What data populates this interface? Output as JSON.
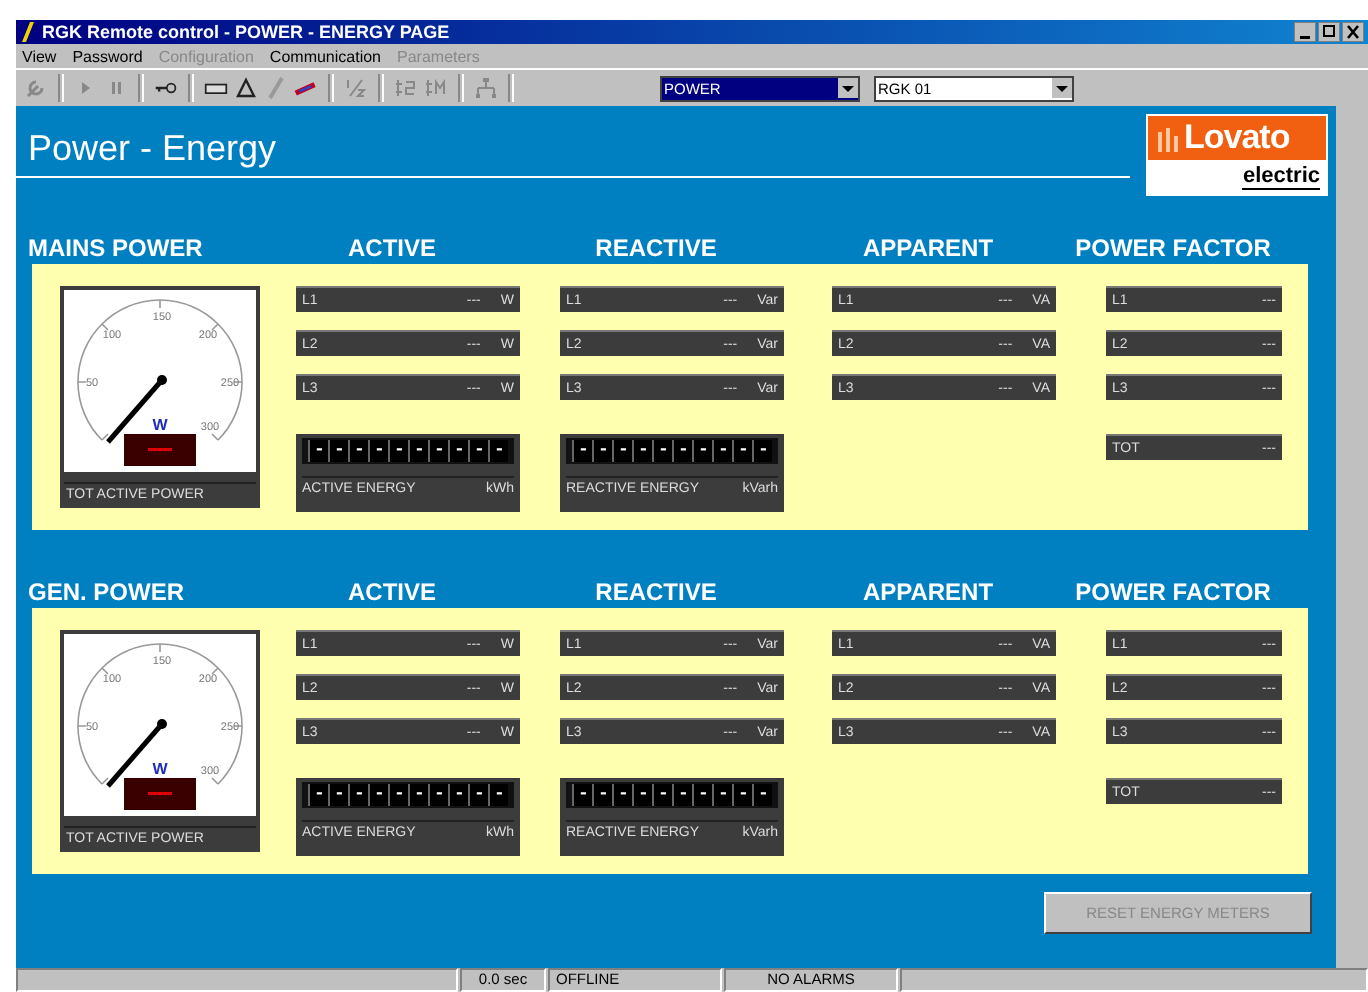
{
  "window": {
    "title": "RGK Remote control - POWER - ENERGY PAGE"
  },
  "menu": [
    {
      "label": "View",
      "disabled": false
    },
    {
      "label": "Password",
      "disabled": false
    },
    {
      "label": "Configuration",
      "disabled": true
    },
    {
      "label": "Communication",
      "disabled": false
    },
    {
      "label": "Parameters",
      "disabled": true
    }
  ],
  "toolbar": {
    "page_select": "POWER",
    "device_select": "RGK 01"
  },
  "page_title": "Power - Energy",
  "logo": {
    "brand": "Lovato",
    "sub": "electric"
  },
  "sections": [
    {
      "title": "MAINS POWER",
      "gauge": {
        "scale": [
          "50",
          "100",
          "150",
          "200",
          "250",
          "300"
        ],
        "unit": "W",
        "label": "TOT ACTIVE POWER"
      },
      "groups": [
        {
          "heading": "ACTIVE",
          "rows": [
            {
              "label": "L1",
              "value": "---",
              "unit": "W"
            },
            {
              "label": "L2",
              "value": "---",
              "unit": "W"
            },
            {
              "label": "L3",
              "value": "---",
              "unit": "W"
            }
          ],
          "energy": {
            "digits": "----------",
            "label": "ACTIVE ENERGY",
            "unit": "kWh"
          }
        },
        {
          "heading": "REACTIVE",
          "rows": [
            {
              "label": "L1",
              "value": "---",
              "unit": "Var"
            },
            {
              "label": "L2",
              "value": "---",
              "unit": "Var"
            },
            {
              "label": "L3",
              "value": "---",
              "unit": "Var"
            }
          ],
          "energy": {
            "digits": "----------",
            "label": "REACTIVE ENERGY",
            "unit": "kVarh"
          }
        },
        {
          "heading": "APPARENT",
          "rows": [
            {
              "label": "L1",
              "value": "---",
              "unit": "VA"
            },
            {
              "label": "L2",
              "value": "---",
              "unit": "VA"
            },
            {
              "label": "L3",
              "value": "---",
              "unit": "VA"
            }
          ]
        },
        {
          "heading": "POWER FACTOR",
          "rows": [
            {
              "label": "L1",
              "value": "---"
            },
            {
              "label": "L2",
              "value": "---"
            },
            {
              "label": "L3",
              "value": "---"
            }
          ],
          "total": {
            "label": "TOT",
            "value": "---"
          }
        }
      ]
    },
    {
      "title": "GEN. POWER",
      "gauge": {
        "scale": [
          "50",
          "100",
          "150",
          "200",
          "250",
          "300"
        ],
        "unit": "W",
        "label": "TOT ACTIVE POWER"
      },
      "groups": [
        {
          "heading": "ACTIVE",
          "rows": [
            {
              "label": "L1",
              "value": "---",
              "unit": "W"
            },
            {
              "label": "L2",
              "value": "---",
              "unit": "W"
            },
            {
              "label": "L3",
              "value": "---",
              "unit": "W"
            }
          ],
          "energy": {
            "digits": "----------",
            "label": "ACTIVE ENERGY",
            "unit": "kWh"
          }
        },
        {
          "heading": "REACTIVE",
          "rows": [
            {
              "label": "L1",
              "value": "---",
              "unit": "Var"
            },
            {
              "label": "L2",
              "value": "---",
              "unit": "Var"
            },
            {
              "label": "L3",
              "value": "---",
              "unit": "Var"
            }
          ],
          "energy": {
            "digits": "----------",
            "label": "REACTIVE ENERGY",
            "unit": "kVarh"
          }
        },
        {
          "heading": "APPARENT",
          "rows": [
            {
              "label": "L1",
              "value": "---",
              "unit": "VA"
            },
            {
              "label": "L2",
              "value": "---",
              "unit": "VA"
            },
            {
              "label": "L3",
              "value": "---",
              "unit": "VA"
            }
          ]
        },
        {
          "heading": "POWER FACTOR",
          "rows": [
            {
              "label": "L1",
              "value": "---"
            },
            {
              "label": "L2",
              "value": "---"
            },
            {
              "label": "L3",
              "value": "---"
            }
          ],
          "total": {
            "label": "TOT",
            "value": "---"
          }
        }
      ]
    }
  ],
  "reset_button": {
    "label": "RESET ENERGY METERS",
    "disabled": true
  },
  "status_bar": [
    "0.0 sec",
    "OFFLINE",
    "NO ALARMS"
  ]
}
